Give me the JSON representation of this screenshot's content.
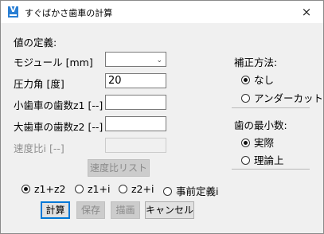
{
  "window": {
    "title": "すぐばかさ歯車の計算",
    "close_label": "×"
  },
  "form": {
    "heading": "値の定義:",
    "module_label": "モジュール [mm]",
    "module_value": "",
    "pressure_angle_label": "圧力角 [度]",
    "pressure_angle_value": "20",
    "z1_label": "小歯車の歯数z1 [--]",
    "z1_value": "",
    "z2_label": "大歯車の歯数z2 [--]",
    "z2_value": "",
    "ratio_label": "速度比i [--]",
    "ratio_value": "",
    "ratio_list_button": "速度比リスト"
  },
  "mode_options": [
    {
      "label": "z1+z2",
      "selected": true
    },
    {
      "label": "z1+i",
      "selected": false
    },
    {
      "label": "z2+i",
      "selected": false
    },
    {
      "label": "事前定義i",
      "selected": false
    }
  ],
  "buttons": {
    "calculate": "計算",
    "save": "保存",
    "draw": "描画",
    "cancel": "キャンセル"
  },
  "correction": {
    "heading": "補正方法:",
    "options": [
      {
        "label": "なし",
        "selected": true
      },
      {
        "label": "アンダーカット",
        "selected": false
      }
    ]
  },
  "min_teeth": {
    "heading": "歯の最小数:",
    "options": [
      {
        "label": "実際",
        "selected": true
      },
      {
        "label": "理論上",
        "selected": false
      }
    ]
  }
}
